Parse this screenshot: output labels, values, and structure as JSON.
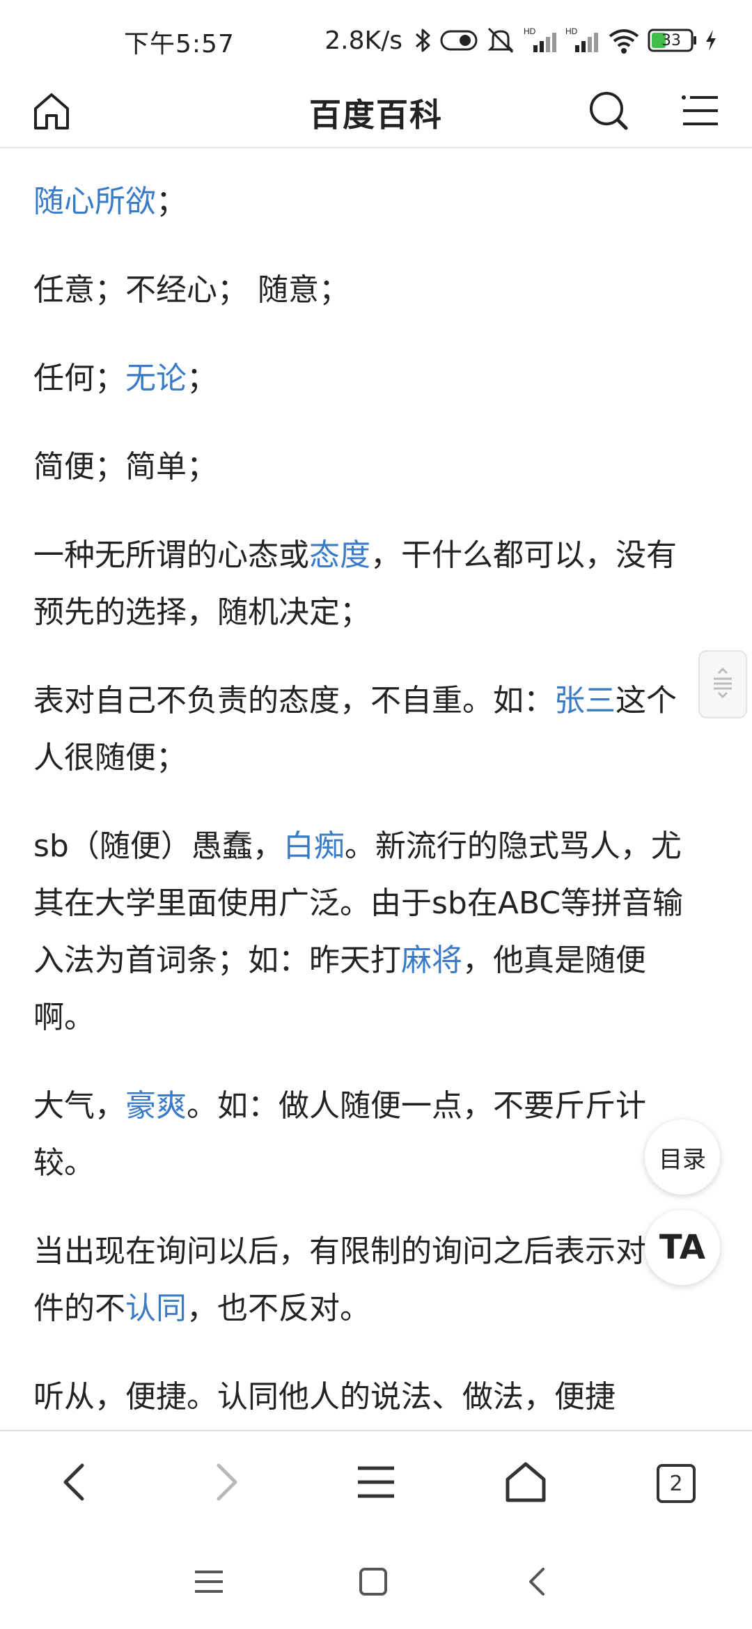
{
  "status_bar": {
    "time": "下午5:57",
    "net_speed": "2.8K/s",
    "battery_level": "33",
    "icons": [
      "bluetooth-icon",
      "toggle-icon",
      "mute-icon",
      "signal-hd-icon",
      "signal-hd-icon",
      "wifi-icon",
      "battery-icon",
      "charging-icon"
    ]
  },
  "header": {
    "title": "百度百科",
    "icons": [
      "home-icon",
      "search-icon",
      "menu-icon"
    ]
  },
  "article": {
    "paragraphs": [
      {
        "segments": [
          {
            "text": "随心所欲",
            "link": true
          },
          {
            "text": "；",
            "link": false
          }
        ]
      },
      {
        "segments": [
          {
            "text": "任意；不经心； 随意；",
            "link": false
          }
        ]
      },
      {
        "segments": [
          {
            "text": "任何；",
            "link": false
          },
          {
            "text": "无论",
            "link": true
          },
          {
            "text": "；",
            "link": false
          }
        ]
      },
      {
        "segments": [
          {
            "text": "简便；简单；",
            "link": false
          }
        ]
      },
      {
        "segments": [
          {
            "text": "一种无所谓的心态或",
            "link": false
          },
          {
            "text": "态度",
            "link": true
          },
          {
            "text": "，干什么都可以，没有预先的选择，随机决定；",
            "link": false
          }
        ]
      },
      {
        "segments": [
          {
            "text": "表对自己不负责的态度，不自重。如：",
            "link": false
          },
          {
            "text": "张三",
            "link": true
          },
          {
            "text": "这个人很随便；",
            "link": false
          }
        ]
      },
      {
        "segments": [
          {
            "text": "sb（随便）愚蠢，",
            "link": false
          },
          {
            "text": "白痴",
            "link": true
          },
          {
            "text": "。新流行的隐式骂人，尤其在大学里面使用广泛。由于sb在ABC等拼音输入法为首词条；如：昨天打",
            "link": false
          },
          {
            "text": "麻将",
            "link": true
          },
          {
            "text": "，他真是随便啊。",
            "link": false
          }
        ]
      },
      {
        "segments": [
          {
            "text": "大气，",
            "link": false
          },
          {
            "text": "豪爽",
            "link": true
          },
          {
            "text": "。如：做人随便一点，不要斤斤计较。",
            "link": false
          }
        ]
      },
      {
        "segments": [
          {
            "text": "当出现在询问以后，有限制的询问之后表示对条件的不",
            "link": false
          },
          {
            "text": "认同",
            "link": true
          },
          {
            "text": "，也不反对。",
            "link": false
          }
        ]
      },
      {
        "segments": [
          {
            "text": "听从，便捷。认同他人的说法、做法，便捷",
            "link": false
          }
        ]
      }
    ]
  },
  "floating": {
    "toc_label": "目录",
    "ta_label": "TA",
    "scroll_handle_icon": "scroll-handle-icon"
  },
  "browser_toolbar": {
    "tabs_count": "2",
    "icons": [
      "back-icon",
      "forward-icon",
      "menu-icon",
      "home-icon",
      "tabs-icon"
    ]
  },
  "system_nav": {
    "icons": [
      "recents-icon",
      "home-square-icon",
      "back-icon"
    ]
  },
  "colors": {
    "link": "#3a7bc8",
    "text": "#222222",
    "divider": "#e6e6e6",
    "disabled": "#b8b8b8"
  }
}
